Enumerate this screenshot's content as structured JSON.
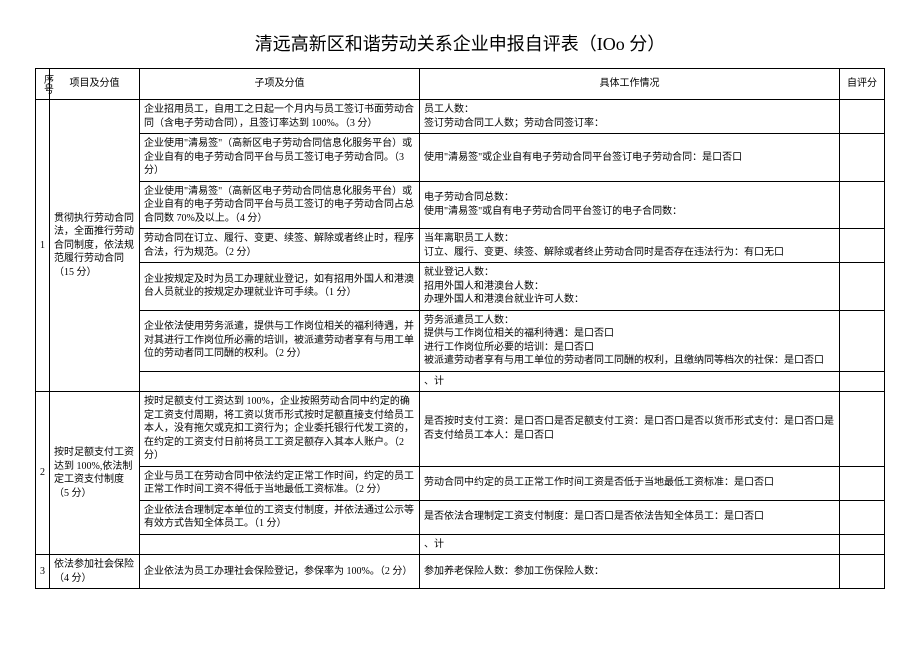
{
  "title": "清远高新区和谐劳动关系企业申报自评表（IOo 分）",
  "headers": {
    "seq": "序号",
    "project": "项目及分值",
    "subitem": "子项及分值",
    "work": "具体工作情况",
    "score": "自评分"
  },
  "rows": [
    {
      "seq": "1",
      "project": "贯彻执行劳动合同法，全面推行劳动合同制度，依法规范履行劳动合同（15 分）",
      "subitems": [
        {
          "sub": "企业招用员工，自用工之日起一个月内与员工签订书面劳动合同（含电子劳动合同），且签订率达到 100%。（3 分）",
          "work": "员工人数：\n签订劳动合同工人数；劳动合同签订率："
        },
        {
          "sub": "企业使用\"清易签\"（高新区电子劳动合同信息化服务平台）或企业自有的电子劳动合同平台与员工签订电子劳动合同。（3 分）",
          "work": "使用\"清易签\"或企业自有电子劳动合同平台签订电子劳动合同：是口否口"
        },
        {
          "sub": "企业使用\"清易签\"（高新区电子劳动合同信息化服务平台）或企业自有的电子劳动合同平台与员工签订的电子劳动合同占总合同数 70%及以上。（4 分）",
          "work": "电子劳动合同总数：\n使用\"清易签\"或自有电子劳动合同平台签订的电子合同数："
        },
        {
          "sub": "劳动合同在订立、履行、变更、续签、解除或者终止时，程序合法，行为规范。（2 分）",
          "work": "当年离职员工人数：\n订立、履行、变更、续签、解除或者终止劳动合同时是否存在违法行为：有口无口"
        },
        {
          "sub": "企业按规定及时为员工办理就业登记，如有招用外国人和港澳台人员就业的按规定办理就业许可手续。（1 分）",
          "work": "就业登记人数：\n招用外国人和港澳台人数：\n办理外国人和港澳台就业许可人数："
        },
        {
          "sub": "企业依法使用劳务派遣，提供与工作岗位相关的福利待遇，并对其进行工作岗位所必需的培训，被派遣劳动者享有与用工单位的劳动者同工同酬的权利。（2 分）",
          "work": "劳务派遣员工人数：\n提供与工作岗位相关的福利待遇：是口否口\n进行工作岗位所必要的培训：是口否口\n被派遣劳动者享有与用工单位的劳动者同工同酬的权利，且缴纳同等档次的社保：是口否口"
        },
        {
          "sub": "",
          "work": "、计"
        }
      ]
    },
    {
      "seq": "2",
      "project": "按时足额支付工资达到 100%,依法制定工资支付制度（5 分）",
      "subitems": [
        {
          "sub": "按时足额支付工资达到 100%，企业按照劳动合同中约定的确定工资支付周期，将工资以货币形式按时足额直接支付给员工本人，没有拖欠或克扣工资行为；企业委托银行代发工资的，在约定的工资支付日前将员工工资足额存入其本人账户。（2 分）",
          "work": "是否按时支付工资：是口否口是否足额支付工资：是口否口是否以货币形式支付：是口否口是否支付给员工本人：是口否口"
        },
        {
          "sub": "企业与员工在劳动合同中依法约定正常工作时间，约定的员工正常工作时间工资不得低于当地最低工资标准。（2 分）",
          "work": "劳动合同中约定的员工正常工作时间工资是否低于当地最低工资标准：是口否口"
        },
        {
          "sub": "企业依法合理制定本单位的工资支付制度，并依法通过公示等有效方式告知全体员工。（1 分）",
          "work": "是否依法合理制定工资支付制度：是口否口是否依法告知全体员工：是口否口"
        },
        {
          "sub": "",
          "work": "、计"
        }
      ]
    },
    {
      "seq": "3",
      "project": "依法参加社会保险（4 分）",
      "subitems": [
        {
          "sub": "企业依法为员工办理社会保险登记，参保率为 100%。（2 分）",
          "work": "参加养老保险人数：参加工伤保险人数："
        }
      ]
    }
  ]
}
